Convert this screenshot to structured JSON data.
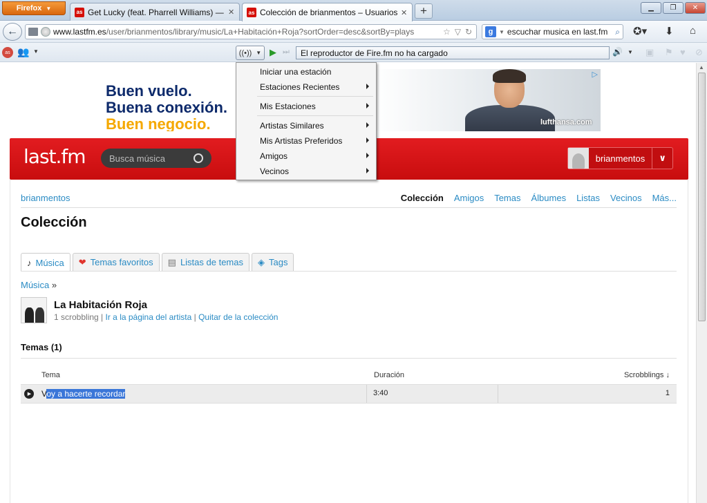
{
  "browser": {
    "app_button": "Firefox",
    "tabs": [
      {
        "title": "Get Lucky (feat. Pharrell Williams) — ...",
        "icon": "lastfm-favicon"
      },
      {
        "title": "Colección de brianmentos – Usuarios...",
        "icon": "lastfm-favicon"
      }
    ],
    "url_prefix": "www.lastfm.es",
    "url_rest": "/user/brianmentos/library/music/La+Habitación+Roja?sortOrder=desc&sortBy=plays",
    "search_text": "escuchar musica en last.fm"
  },
  "addon": {
    "player_status": "El reproductor de Fire.fm no ha cargado"
  },
  "menu": {
    "items": [
      {
        "label": "Iniciar una estación",
        "submenu": false
      },
      {
        "label": "Estaciones Recientes",
        "submenu": true
      },
      {
        "label": "Mis Estaciones",
        "submenu": true
      },
      {
        "label": "Artistas Similares",
        "submenu": true
      },
      {
        "label": "Mis Artistas Preferidos",
        "submenu": true
      },
      {
        "label": "Amigos",
        "submenu": true
      },
      {
        "label": "Vecinos",
        "submenu": true
      }
    ]
  },
  "ad": {
    "line1": "Buen vuelo.",
    "line2": "Buena conexión.",
    "line3": "Buen negocio.",
    "brand": "lufthansa.com",
    "colors": {
      "navy": "#0d2a6b",
      "yellow": "#f5a800"
    }
  },
  "lastfm": {
    "logo": "last.fm",
    "search_placeholder": "Busca música",
    "username": "brianmentos",
    "brand_color": "#d51007"
  },
  "page": {
    "user_link": "brianmentos",
    "subnav": [
      "Colección",
      "Amigos",
      "Temas",
      "Álbumes",
      "Listas",
      "Vecinos",
      "Más..."
    ],
    "title": "Colección",
    "tabs": [
      {
        "label": "Música",
        "icon": "music-note-icon"
      },
      {
        "label": "Temas favoritos",
        "icon": "heart-icon"
      },
      {
        "label": "Listas de temas",
        "icon": "list-icon"
      },
      {
        "label": "Tags",
        "icon": "tag-icon"
      }
    ],
    "crumb": "Música",
    "crumb_sep": "»",
    "artist": {
      "name": "La Habitación Roja",
      "scrobbling": "1 scrobbling",
      "link_artist": "Ir a la página del artista",
      "link_remove": "Quitar de la colección"
    },
    "section": "Temas (1)",
    "table": {
      "headers": [
        "Tema",
        "Duración",
        "Scrobblings ↓"
      ],
      "rows": [
        {
          "title_first": "V",
          "title_rest": "oy a hacerte recordar",
          "duration": "3:40",
          "scrobblings": "1"
        }
      ]
    }
  }
}
